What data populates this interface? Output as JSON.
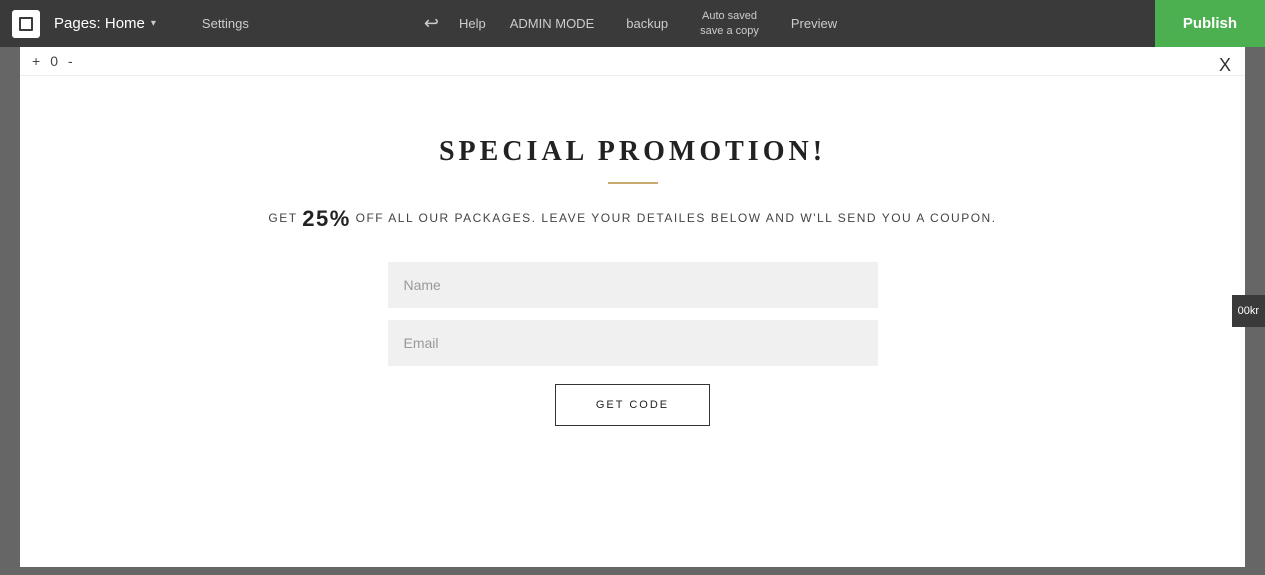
{
  "topbar": {
    "logo_label": "Logo",
    "pages_title": "Pages: Home",
    "chevron": "▾",
    "settings_label": "Settings",
    "undo_icon": "↩",
    "help_label": "Help",
    "admin_mode_label": "ADMIN MODE",
    "backup_label": "backup",
    "autosave_line1": "Auto saved",
    "autosave_line2": "save a copy",
    "preview_label": "Preview",
    "publish_label": "Publish"
  },
  "panel": {
    "toolbar_plus": "+",
    "toolbar_zero": "0",
    "toolbar_minus": "-",
    "close_label": "X"
  },
  "promo": {
    "title": "SPECIAL PROMOTION!",
    "description_pre": "GET",
    "description_pct": "25%",
    "description_post": "OFF ALL OUR PACKAGES. LEAVE YOUR DETAILES BELOW AND W'LL SEND YOU A COUPON.",
    "name_placeholder": "Name",
    "email_placeholder": "Email",
    "button_label": "GET CODE"
  },
  "right_panel": {
    "label": "00kr"
  }
}
